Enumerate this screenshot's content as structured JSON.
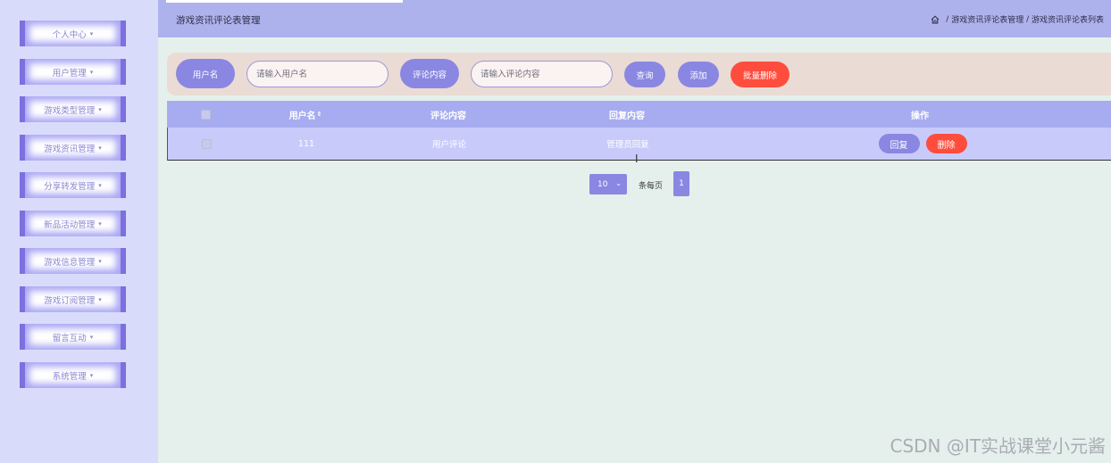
{
  "sidebar": {
    "items": [
      {
        "label": "个人中心"
      },
      {
        "label": "用户管理"
      },
      {
        "label": "游戏类型管理"
      },
      {
        "label": "游戏资讯管理"
      },
      {
        "label": "分享转发管理"
      },
      {
        "label": "新品活动管理"
      },
      {
        "label": "游戏信息管理"
      },
      {
        "label": "游戏订阅管理"
      },
      {
        "label": "留言互动"
      },
      {
        "label": "系统管理"
      }
    ],
    "caret": "▾"
  },
  "header": {
    "title": "游戏资讯评论表管理",
    "breadcrumb": {
      "sep1": " / ",
      "item1": "游戏资讯评论表管理",
      "sep2": " / ",
      "item2": "游戏资讯评论表列表"
    }
  },
  "search": {
    "username_label": "用户名",
    "username_placeholder": "请输入用户名",
    "content_label": "评论内容",
    "content_placeholder": "请输入评论内容",
    "query_button": "查询",
    "add_button": "添加",
    "batch_delete_button": "批量删除"
  },
  "table": {
    "columns": [
      "用户名",
      "评论内容",
      "回复内容",
      "操作"
    ],
    "sort_glyph": "⇕",
    "rows": [
      {
        "username": "111",
        "content": "用户评论",
        "reply": "管理员回复",
        "reply_button": "回复",
        "delete_button": "删除"
      }
    ]
  },
  "pagination": {
    "page_size": "10",
    "per_page_label": "条每页",
    "current_page": "1"
  },
  "watermark": "CSDN @IT实战课堂小元酱",
  "colors": {
    "accent": "#8a87e2",
    "danger": "#ff4d3d",
    "sidebar_bg": "#d8dcfa",
    "header_bg": "#aeb2ec"
  }
}
